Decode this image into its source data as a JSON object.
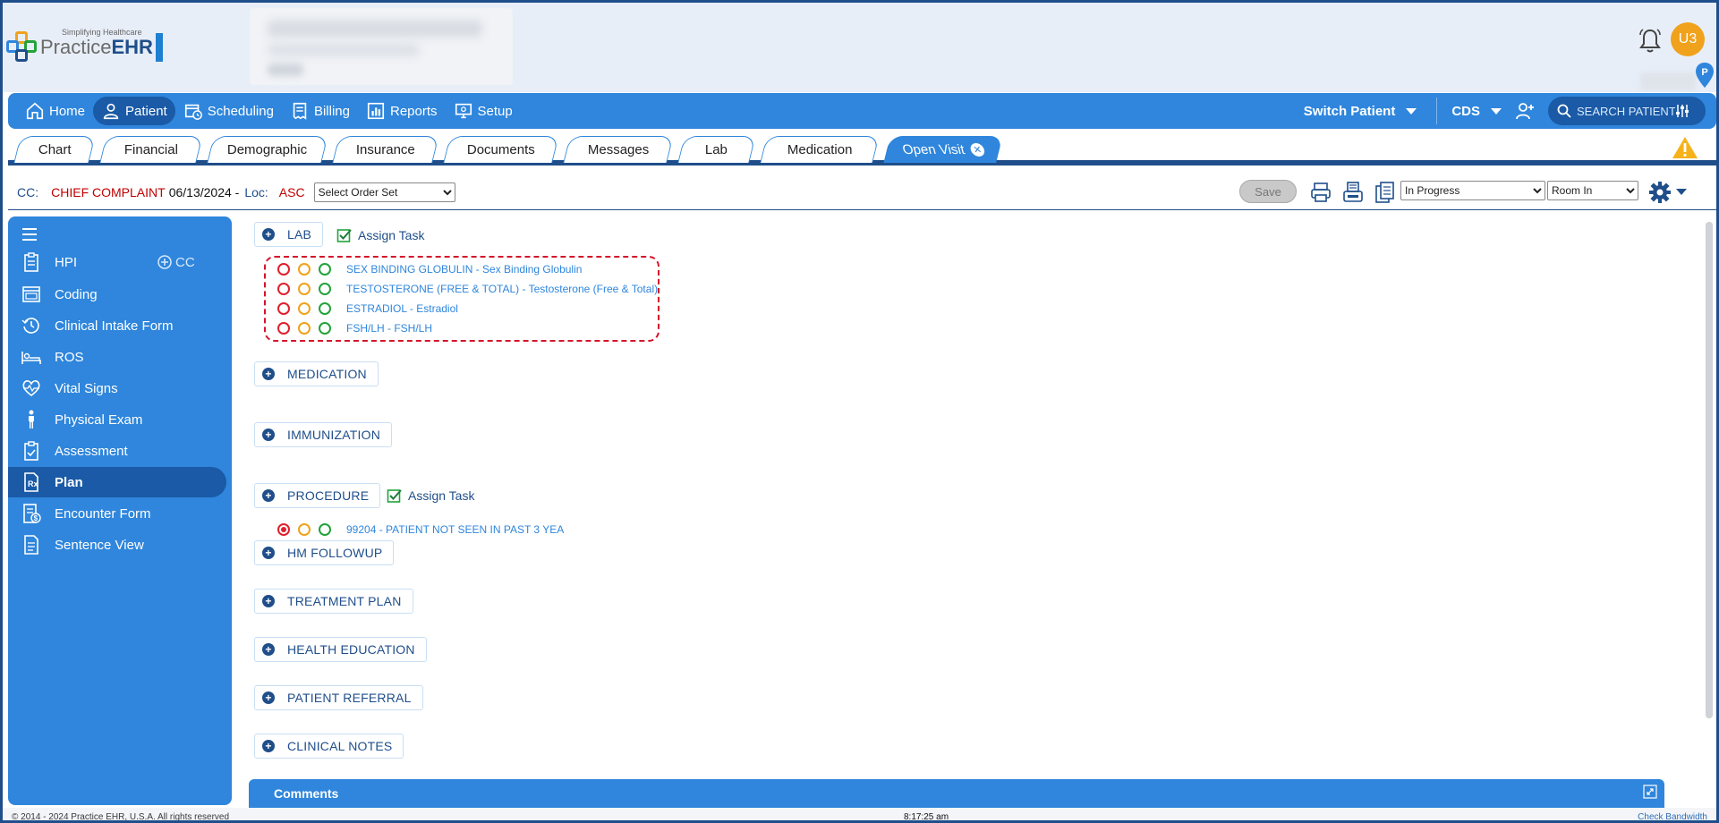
{
  "header": {
    "logo_main": "Practice",
    "logo_bold": "EHR",
    "logo_tagline": "Simplifying Healthcare",
    "user_initials": "U3"
  },
  "nav": {
    "items": [
      {
        "label": "Home",
        "icon": "home-icon"
      },
      {
        "label": "Patient",
        "icon": "user-icon",
        "active": true
      },
      {
        "label": "Scheduling",
        "icon": "calendar-icon"
      },
      {
        "label": "Billing",
        "icon": "invoice-icon"
      },
      {
        "label": "Reports",
        "icon": "chart-icon"
      },
      {
        "label": "Setup",
        "icon": "monitor-settings-icon"
      }
    ],
    "switch_patient": "Switch Patient",
    "cds": "CDS",
    "search_placeholder": "SEARCH PATIENT"
  },
  "tabs": [
    "Chart",
    "Financial",
    "Demographic",
    "Insurance",
    "Documents",
    "Messages",
    "Lab",
    "Medication",
    "Open Visit"
  ],
  "visit": {
    "cc_label": "CC:",
    "chief_complaint": "CHIEF COMPLAINT",
    "date": "06/13/2024 -",
    "loc_label": "Loc:",
    "loc_value": "ASC",
    "order_set": "Select Order Set",
    "save": "Save",
    "status": "In Progress",
    "room": "Room In"
  },
  "sidebar": {
    "cc_link": "CC",
    "items": [
      {
        "label": "HPI",
        "icon": "clipboard-list-icon"
      },
      {
        "label": "Coding",
        "icon": "code-window-icon"
      },
      {
        "label": "Clinical Intake Form",
        "icon": "clock-history-icon"
      },
      {
        "label": "ROS",
        "icon": "bed-icon"
      },
      {
        "label": "Vital Signs",
        "icon": "heart-pulse-icon"
      },
      {
        "label": "Physical Exam",
        "icon": "body-icon"
      },
      {
        "label": "Assessment",
        "icon": "clipboard-check-icon"
      },
      {
        "label": "Plan",
        "icon": "prescription-icon",
        "active": true
      },
      {
        "label": "Encounter Form",
        "icon": "dollar-document-icon"
      },
      {
        "label": "Sentence View",
        "icon": "document-text-icon"
      }
    ]
  },
  "plan": {
    "lab": "LAB",
    "assign_task": "Assign Task",
    "lab_orders": [
      "SEX BINDING GLOBULIN - Sex Binding Globulin",
      "TESTOSTERONE (FREE & TOTAL) - Testosterone (Free & Total)",
      "ESTRADIOL - Estradiol",
      "FSH/LH - FSH/LH"
    ],
    "medication": "MEDICATION",
    "immunization": "IMMUNIZATION",
    "procedure": "PROCEDURE",
    "procedure_orders": [
      "99204 - PATIENT NOT SEEN IN PAST 3 YEA"
    ],
    "hm_followup": "HM FOLLOWUP",
    "treatment_plan": "TREATMENT PLAN",
    "health_education": "HEALTH EDUCATION",
    "patient_referral": "PATIENT REFERRAL",
    "clinical_notes": "CLINICAL NOTES"
  },
  "comments": "Comments",
  "footer": {
    "copyright": "© 2014 - 2024 Practice EHR, U.S.A. All rights reserved",
    "time": "8:17:25 am",
    "bandwidth": "Check Bandwidth"
  },
  "colors": {
    "primary": "#2f86dc",
    "dark": "#1f4e8a",
    "alert_red": "#c00000",
    "status_red": "#e0202c",
    "status_orange": "#f0a21c",
    "status_green": "#22a33a"
  }
}
